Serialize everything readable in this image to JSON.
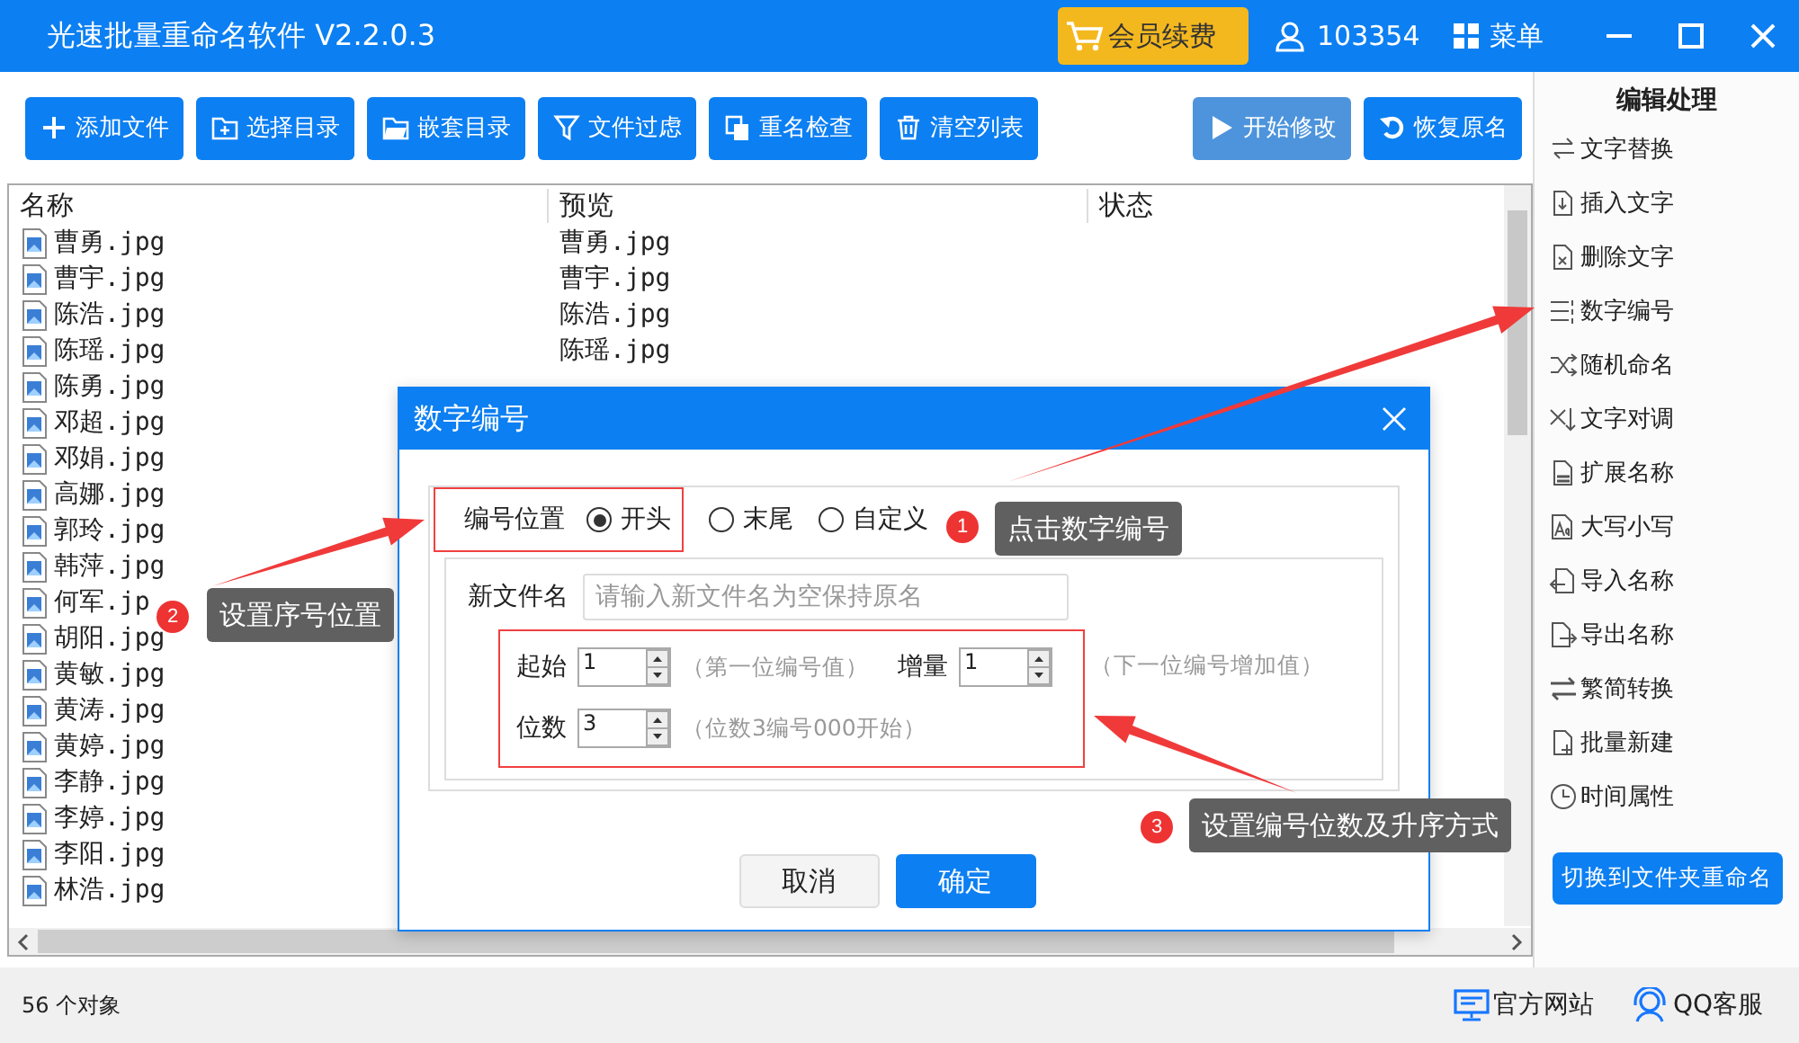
{
  "window": {
    "title": "光速批量重命名软件 V2.2.0.3"
  },
  "header": {
    "vip_button": "会员续费",
    "user_id": "103354",
    "menu": "菜单"
  },
  "toolbar": {
    "left": [
      {
        "kind": "add",
        "label": "添加文件",
        "disabled": false
      },
      {
        "kind": "folder",
        "label": "选择目录",
        "disabled": false
      },
      {
        "kind": "nested",
        "label": "嵌套目录",
        "disabled": false
      },
      {
        "kind": "filter",
        "label": "文件过虑",
        "disabled": false
      },
      {
        "kind": "check",
        "label": "重名检查",
        "disabled": false
      },
      {
        "kind": "clear",
        "label": "清空列表",
        "disabled": false
      }
    ],
    "right": [
      {
        "kind": "start",
        "label": "开始修改",
        "disabled": true
      },
      {
        "kind": "restore",
        "label": "恢复原名",
        "disabled": false
      }
    ]
  },
  "file_list": {
    "columns": [
      "名称",
      "预览",
      "状态"
    ],
    "rows": [
      {
        "name": "曹勇.jpg",
        "preview": "曹勇.jpg"
      },
      {
        "name": "曹宇.jpg",
        "preview": "曹宇.jpg"
      },
      {
        "name": "陈浩.jpg",
        "preview": "陈浩.jpg"
      },
      {
        "name": "陈瑶.jpg",
        "preview": "陈瑶.jpg"
      },
      {
        "name": "陈勇.jpg"
      },
      {
        "name": "邓超.jpg"
      },
      {
        "name": "邓娟.jpg"
      },
      {
        "name": "高娜.jpg"
      },
      {
        "name": "郭玲.jpg"
      },
      {
        "name": "韩萍.jpg"
      },
      {
        "name": "何军.jp"
      },
      {
        "name": "胡阳.jpg"
      },
      {
        "name": "黄敏.jpg"
      },
      {
        "name": "黄涛.jpg"
      },
      {
        "name": "黄婷.jpg"
      },
      {
        "name": "李静.jpg"
      },
      {
        "name": "李婷.jpg"
      },
      {
        "name": "李阳.jpg"
      },
      {
        "name": "林浩.jpg"
      }
    ]
  },
  "sidebar": {
    "heading": "编辑处理",
    "items": [
      {
        "kind": "replace",
        "label": "文字替换"
      },
      {
        "kind": "insert",
        "label": "插入文字"
      },
      {
        "kind": "delete",
        "label": "删除文字"
      },
      {
        "kind": "number",
        "label": "数字编号"
      },
      {
        "kind": "random",
        "label": "随机命名"
      },
      {
        "kind": "swap",
        "label": "文字对调"
      },
      {
        "kind": "extension",
        "label": "扩展名称"
      },
      {
        "kind": "case",
        "label": "大写小写"
      },
      {
        "kind": "import",
        "label": "导入名称"
      },
      {
        "kind": "export",
        "label": "导出名称"
      },
      {
        "kind": "convert",
        "label": "繁简转换"
      },
      {
        "kind": "create",
        "label": "批量新建"
      },
      {
        "kind": "time",
        "label": "时间属性"
      }
    ],
    "switch_button": "切换到文件夹重命名"
  },
  "status_bar": {
    "count": "56 个对象",
    "links": [
      {
        "kind": "website",
        "label": "官方网站"
      },
      {
        "kind": "support",
        "label": "QQ客服"
      }
    ]
  },
  "dialog": {
    "title": "数字编号",
    "position_label": "编号位置",
    "positions": [
      {
        "label": "开头",
        "selected": true
      },
      {
        "label": "末尾",
        "selected": false
      },
      {
        "label": "自定义",
        "selected": false
      }
    ],
    "new_name": {
      "label": "新文件名",
      "placeholder": "请输入新文件名为空保持原名"
    },
    "start": {
      "label": "起始",
      "value": "1",
      "hint": "（第一位编号值）"
    },
    "increment": {
      "label": "增量",
      "value": "1",
      "hint": "（下一位编号增加值）"
    },
    "digits": {
      "label": "位数",
      "value": "3",
      "hint": "（位数3编号000开始）"
    },
    "buttons": [
      {
        "kind": "cancel",
        "label": "取消"
      },
      {
        "kind": "confirm",
        "label": "确定"
      }
    ]
  },
  "annotations": [
    {
      "number": "1",
      "text": "点击数字编号"
    },
    {
      "number": "2",
      "text": "设置序号位置"
    },
    {
      "number": "3",
      "text": "设置编号位数及升序方式"
    }
  ]
}
